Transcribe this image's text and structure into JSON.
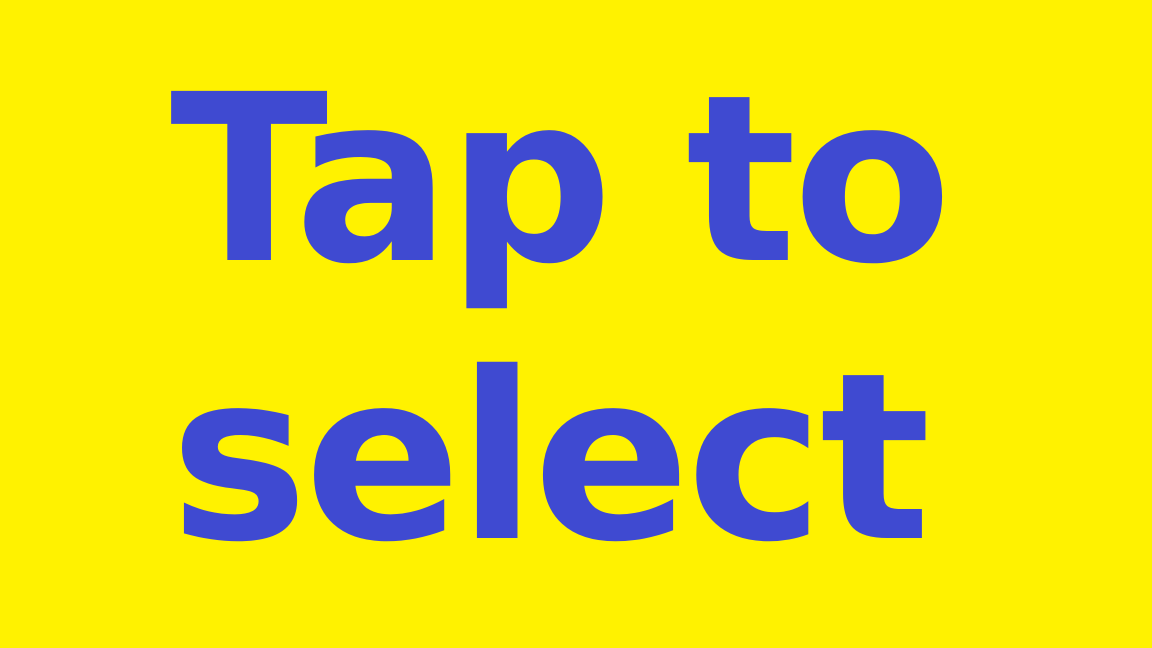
{
  "screen": {
    "background_color": "#FFF200",
    "text_color": "#3F4AD1",
    "prompt_lines": [
      "Tap to",
      "select"
    ]
  }
}
